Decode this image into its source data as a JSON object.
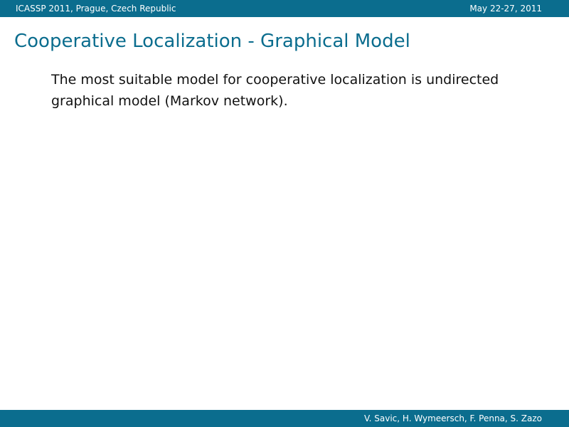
{
  "header": {
    "conference": "ICASSP 2011, Prague, Czech Republic",
    "date": "May 22-27, 2011"
  },
  "slide": {
    "title": "Cooperative Localization - Graphical Model",
    "body": "The most suitable model for cooperative localization is undirected graphical model (Markov network)."
  },
  "footer": {
    "authors": "V. Savic, H. Wymeersch, F. Penna, S. Zazo"
  },
  "colors": {
    "accent": "#0b6d8e",
    "text": "#111111",
    "background": "#ffffff"
  }
}
